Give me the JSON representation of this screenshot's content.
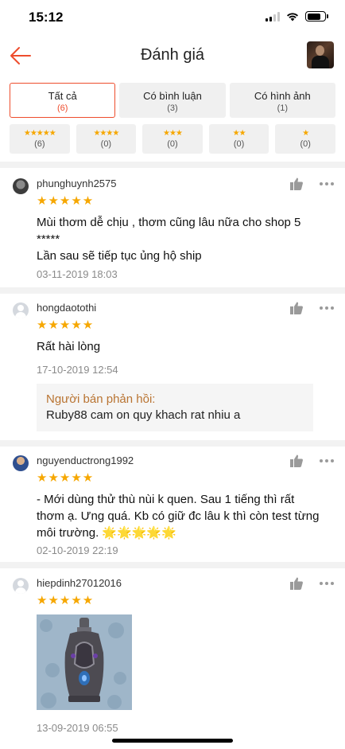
{
  "status_bar": {
    "time": "15:12"
  },
  "header": {
    "title": "Đánh giá",
    "back_icon": "arrow-left-icon",
    "accent": "#ee4d2d"
  },
  "filters": {
    "tabs": [
      {
        "label": "Tất cả",
        "count": "(6)",
        "active": true
      },
      {
        "label": "Có bình luận",
        "count": "(3)",
        "active": false
      },
      {
        "label": "Có hình ảnh",
        "count": "(1)",
        "active": false
      }
    ],
    "stars": [
      {
        "stars": "★★★★★",
        "count": "(6)"
      },
      {
        "stars": "★★★★",
        "count": "(0)"
      },
      {
        "stars": "★★★",
        "count": "(0)"
      },
      {
        "stars": "★★",
        "count": "(0)"
      },
      {
        "stars": "★",
        "count": "(0)"
      }
    ]
  },
  "reviews": [
    {
      "username": "phunghuynh2575",
      "rating": 5,
      "stars": "★★★★★",
      "comment": "Mùi thơm dễ chịu , thơm cũng lâu nữa cho shop 5\n*****\nLần sau sẽ tiếp tục ủng hộ ship",
      "date": "03-11-2019 18:03"
    },
    {
      "username": "hongdaotothi",
      "rating": 5,
      "stars": "★★★★★",
      "comment": "Rất hài lòng",
      "date": "17-10-2019 12:54",
      "reply": {
        "label": "Người bán phản hồi:",
        "text": "Ruby88 cam on quy khach rat nhiu a"
      }
    },
    {
      "username": "nguyenductrong1992",
      "rating": 5,
      "stars": "★★★★★",
      "comment": "- Mới dùng thử thù nùi k quen. Sau 1 tiếng thì rất thơm ạ. Ưng quá. Kb có giữ đc lâu k thì còn test từng môi trường. 🌟🌟🌟🌟🌟",
      "date": "02-10-2019 22:19"
    },
    {
      "username": "hiepdinh27012016",
      "rating": 5,
      "stars": "★★★★★",
      "date": "13-09-2019 06:55"
    }
  ]
}
